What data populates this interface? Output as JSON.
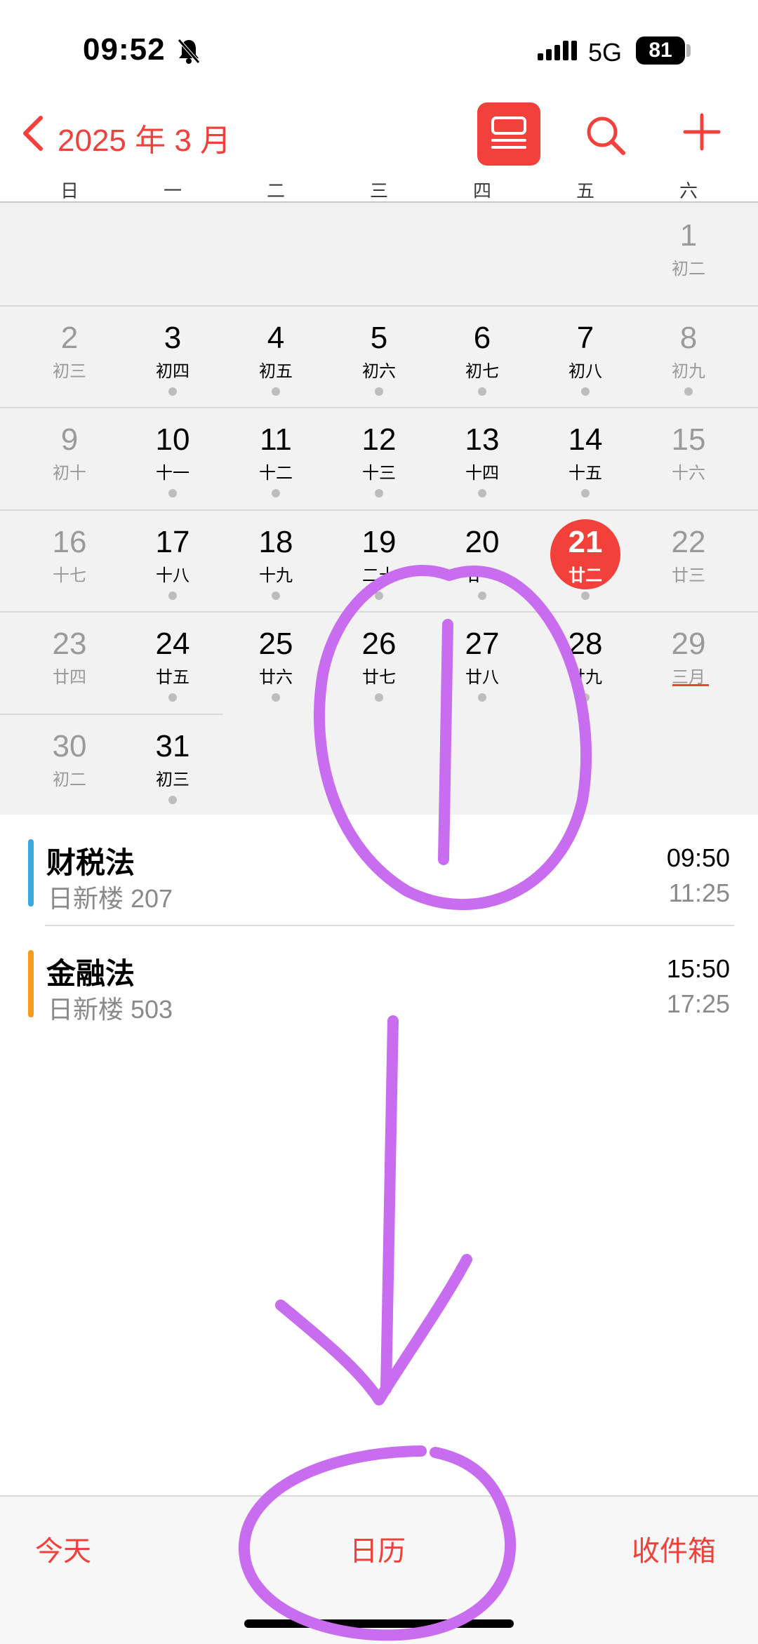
{
  "status_bar": {
    "time": "09:52",
    "network": "5G",
    "battery": "81"
  },
  "header": {
    "month": "2025 年 3 月"
  },
  "weekdays": [
    "日",
    "一",
    "二",
    "三",
    "四",
    "五",
    "六"
  ],
  "calendar": {
    "weeks": [
      [
        null,
        null,
        null,
        null,
        null,
        null,
        {
          "d": "1",
          "l": "初二"
        }
      ],
      [
        {
          "d": "2",
          "l": "初三"
        },
        {
          "d": "3",
          "l": "初四",
          "e": true
        },
        {
          "d": "4",
          "l": "初五",
          "e": true
        },
        {
          "d": "5",
          "l": "初六",
          "e": true
        },
        {
          "d": "6",
          "l": "初七",
          "e": true
        },
        {
          "d": "7",
          "l": "初八",
          "e": true
        },
        {
          "d": "8",
          "l": "初九",
          "e": true
        }
      ],
      [
        {
          "d": "9",
          "l": "初十"
        },
        {
          "d": "10",
          "l": "十一",
          "e": true
        },
        {
          "d": "11",
          "l": "十二",
          "e": true
        },
        {
          "d": "12",
          "l": "十三",
          "e": true
        },
        {
          "d": "13",
          "l": "十四",
          "e": true
        },
        {
          "d": "14",
          "l": "十五",
          "e": true
        },
        {
          "d": "15",
          "l": "十六"
        }
      ],
      [
        {
          "d": "16",
          "l": "十七"
        },
        {
          "d": "17",
          "l": "十八",
          "e": true
        },
        {
          "d": "18",
          "l": "十九",
          "e": true
        },
        {
          "d": "19",
          "l": "二十",
          "e": true
        },
        {
          "d": "20",
          "l": "廿一",
          "e": true
        },
        {
          "d": "21",
          "l": "廿二",
          "e": true,
          "today": true
        },
        {
          "d": "22",
          "l": "廿三"
        }
      ],
      [
        {
          "d": "23",
          "l": "廿四"
        },
        {
          "d": "24",
          "l": "廿五",
          "e": true
        },
        {
          "d": "25",
          "l": "廿六",
          "e": true
        },
        {
          "d": "26",
          "l": "廿七",
          "e": true
        },
        {
          "d": "27",
          "l": "廿八",
          "e": true
        },
        {
          "d": "28",
          "l": "廿九",
          "e": true
        },
        {
          "d": "29",
          "l": "三月"
        }
      ],
      [
        {
          "d": "30",
          "l": "初二"
        },
        {
          "d": "31",
          "l": "初三",
          "e": true
        },
        null,
        null,
        null,
        null,
        null
      ]
    ]
  },
  "events": [
    {
      "title": "财税法",
      "location": "日新楼 207",
      "start": "09:50",
      "end": "11:25",
      "color": "#3aa8e0"
    },
    {
      "title": "金融法",
      "location": "日新楼 503",
      "start": "15:50",
      "end": "17:25",
      "color": "#f59d1b"
    }
  ],
  "tabs": {
    "today": "今天",
    "calendars": "日历",
    "inbox": "收件箱"
  },
  "colors": {
    "accent": "#f2403a",
    "annotation": "#c86cf0"
  }
}
